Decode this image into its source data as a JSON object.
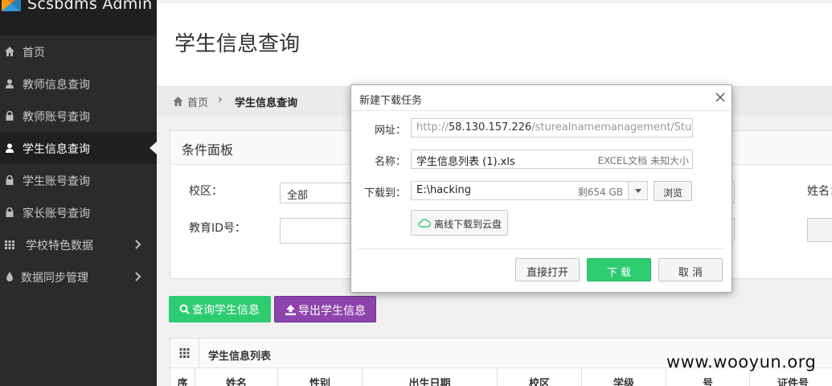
{
  "brand": {
    "title": "Scsbdms Admin"
  },
  "sidebar": {
    "items": [
      {
        "label": "首页",
        "icon": "home-icon"
      },
      {
        "label": "教师信息查询",
        "icon": "user-icon"
      },
      {
        "label": "教师账号查询",
        "icon": "lock-icon"
      },
      {
        "label": "学生信息查询",
        "icon": "user-icon",
        "active": true
      },
      {
        "label": "学生账号查询",
        "icon": "lock-icon"
      },
      {
        "label": "家长账号查询",
        "icon": "lock-icon"
      },
      {
        "label": "学校特色数据",
        "icon": "grid-icon",
        "has_children": true
      },
      {
        "label": "数据同步管理",
        "icon": "drop-icon",
        "has_children": true
      }
    ]
  },
  "page": {
    "title": "学生信息查询"
  },
  "breadcrumb": {
    "home": "首页",
    "separator": "›",
    "current": "学生信息查询"
  },
  "conditions": {
    "title": "条件面板",
    "campus_label": "校区：",
    "campus_value": "全部",
    "edu_id_label": "教育ID号：",
    "name_label": "姓名："
  },
  "actions": {
    "query": "查询学生信息",
    "export": "导出学生信息"
  },
  "list": {
    "title": "学生信息列表",
    "columns": [
      "序",
      "姓名",
      "性别",
      "出生日期",
      "校区",
      "学级",
      "号",
      "证件号"
    ]
  },
  "dialog": {
    "title": "新建下载任务",
    "url_label": "网址：",
    "url_prefix": "http://",
    "url_host": "58.130.157.226",
    "url_path": "/sturealnamemanagement/StuRealNa",
    "name_label": "名称：",
    "name_value": "学生信息列表 (1).xls",
    "name_meta": "EXCEL文档 未知大小",
    "dir_label": "下载到：",
    "dir_value": "E:\\hacking",
    "dir_free": "剩654 GB",
    "browse": "浏览",
    "cloud": "离线下载到云盘",
    "open": "直接打开",
    "download": "下 载",
    "cancel": "取 消"
  },
  "watermark": "www.wooyun.org",
  "colors": {
    "sidebar": "#2b2b2b",
    "green": "#2ecc71",
    "purple": "#8e44ad"
  }
}
